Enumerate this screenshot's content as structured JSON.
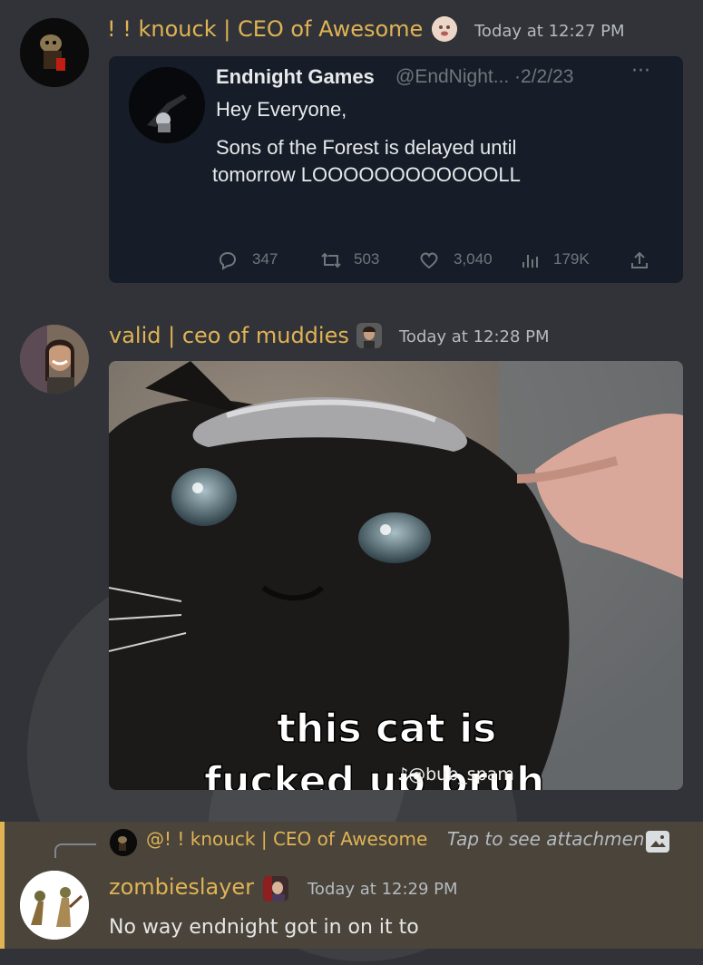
{
  "messages": [
    {
      "username": "! ! knouck | CEO of Awesome",
      "timestamp": "Today at 12:27 PM",
      "embed": {
        "author_name": "Endnight Games",
        "author_handle": "@EndNight... ·2/2/23",
        "more": "···",
        "line1": "Hey Everyone,",
        "line2": "Sons of the Forest is delayed until",
        "line3": "tomorrow LOOOOOOOOOOOOLL",
        "replies": "347",
        "retweets": "503",
        "likes": "3,040",
        "views": "179K"
      }
    },
    {
      "username": "valid | ceo of muddies",
      "timestamp": "Today at 12:28 PM",
      "image": {
        "caption_line1": "this cat is",
        "caption_line2": "fucked up bruh",
        "watermark": "♪@bub_spam"
      }
    },
    {
      "reply": {
        "mention": "@! ! knouck | CEO of Awesome",
        "hint": "Tap to see attachment"
      },
      "username": "zombieslayer",
      "timestamp": "Today at 12:29 PM",
      "text": "No way endnight  got in on it to"
    }
  ],
  "colors": {
    "background": "#313338",
    "username": "#e0b355",
    "reply_highlight": "#4a443a",
    "tweet_bg": "#161d28"
  },
  "icons": [
    "reply-icon",
    "retweet-icon",
    "like-icon",
    "views-icon",
    "share-icon",
    "image-icon"
  ]
}
